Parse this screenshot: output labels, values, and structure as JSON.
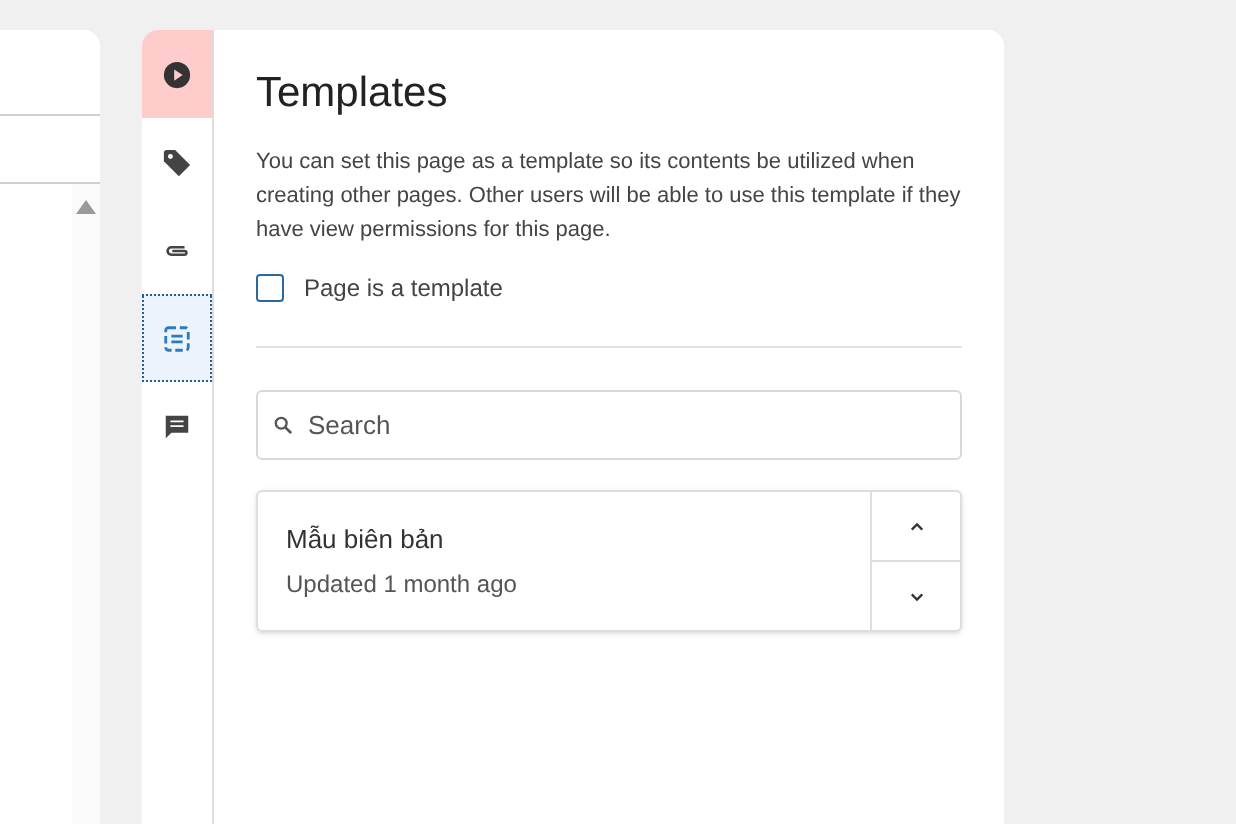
{
  "sidebar_tabs": [
    {
      "selected": false,
      "highlighted": true
    },
    {
      "selected": false,
      "highlighted": false
    },
    {
      "selected": false,
      "highlighted": false
    },
    {
      "selected": true,
      "highlighted": false
    },
    {
      "selected": false,
      "highlighted": false
    }
  ],
  "panel": {
    "title": "Templates",
    "description": "You can set this page as a template so its contents be utilized when creating other pages. Other users will be able to use this template if they have view permissions for this page.",
    "checkbox": {
      "label": "Page is a template",
      "checked": false
    },
    "search": {
      "placeholder": "Search"
    },
    "templates": [
      {
        "name": "Mẫu biên bản",
        "updated": "Updated 1 month ago"
      }
    ]
  }
}
